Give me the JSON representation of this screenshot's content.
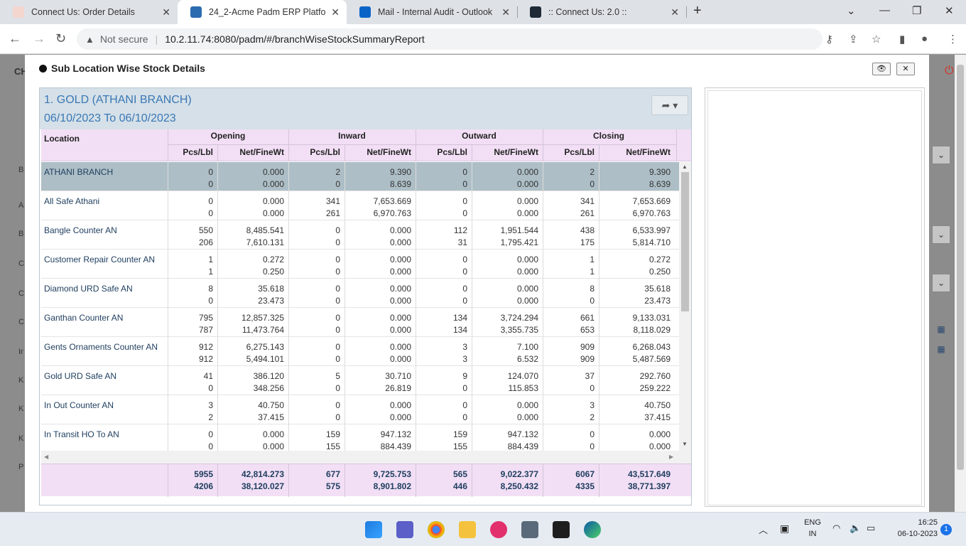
{
  "browser": {
    "tabs": [
      {
        "title": "Connect Us: Order Details",
        "active": false
      },
      {
        "title": "24_2-Acme Padm ERP Platform",
        "active": true
      },
      {
        "title": "Mail - Internal Audit - Outlook",
        "active": false
      },
      {
        "title": ":: Connect Us: 2.0 ::",
        "active": false
      }
    ],
    "security_label": "Not secure",
    "url": "10.2.11.74:8080/padm/#/branchWiseStockSummaryReport"
  },
  "background_page": {
    "letters": [
      "CH",
      "B",
      "A",
      "B",
      "C",
      "C",
      "C",
      "Ir",
      "K",
      "K",
      "K",
      "P"
    ]
  },
  "modal": {
    "title": "Sub Location Wise Stock Details",
    "panel": {
      "heading": "1. GOLD (ATHANI BRANCH)",
      "date_range": "06/10/2023 To 06/10/2023"
    },
    "table": {
      "location_header": "Location",
      "groups": [
        "Opening",
        "Inward",
        "Outward",
        "Closing"
      ],
      "sub_headers": [
        "Pcs/Lbl",
        "Net/FineWt"
      ],
      "rows": [
        {
          "location": "ATHANI BRANCH",
          "selected": true,
          "values": [
            [
              "0",
              "0"
            ],
            [
              "0.000",
              "0.000"
            ],
            [
              "2",
              "0"
            ],
            [
              "9.390",
              "8.639"
            ],
            [
              "0",
              "0"
            ],
            [
              "0.000",
              "0.000"
            ],
            [
              "2",
              "0"
            ],
            [
              "9.390",
              "8.639"
            ]
          ]
        },
        {
          "location": "All Safe Athani",
          "selected": false,
          "values": [
            [
              "0",
              "0"
            ],
            [
              "0.000",
              "0.000"
            ],
            [
              "341",
              "261"
            ],
            [
              "7,653.669",
              "6,970.763"
            ],
            [
              "0",
              "0"
            ],
            [
              "0.000",
              "0.000"
            ],
            [
              "341",
              "261"
            ],
            [
              "7,653.669",
              "6,970.763"
            ]
          ]
        },
        {
          "location": "Bangle Counter AN",
          "selected": false,
          "values": [
            [
              "550",
              "206"
            ],
            [
              "8,485.541",
              "7,610.131"
            ],
            [
              "0",
              "0"
            ],
            [
              "0.000",
              "0.000"
            ],
            [
              "112",
              "31"
            ],
            [
              "1,951.544",
              "1,795.421"
            ],
            [
              "438",
              "175"
            ],
            [
              "6,533.997",
              "5,814.710"
            ]
          ]
        },
        {
          "location": "Customer Repair Counter AN",
          "selected": false,
          "values": [
            [
              "1",
              "1"
            ],
            [
              "0.272",
              "0.250"
            ],
            [
              "0",
              "0"
            ],
            [
              "0.000",
              "0.000"
            ],
            [
              "0",
              "0"
            ],
            [
              "0.000",
              "0.000"
            ],
            [
              "1",
              "1"
            ],
            [
              "0.272",
              "0.250"
            ]
          ]
        },
        {
          "location": "Diamond URD Safe AN",
          "selected": false,
          "values": [
            [
              "8",
              "0"
            ],
            [
              "35.618",
              "23.473"
            ],
            [
              "0",
              "0"
            ],
            [
              "0.000",
              "0.000"
            ],
            [
              "0",
              "0"
            ],
            [
              "0.000",
              "0.000"
            ],
            [
              "8",
              "0"
            ],
            [
              "35.618",
              "23.473"
            ]
          ]
        },
        {
          "location": "Ganthan Counter AN",
          "selected": false,
          "values": [
            [
              "795",
              "787"
            ],
            [
              "12,857.325",
              "11,473.764"
            ],
            [
              "0",
              "0"
            ],
            [
              "0.000",
              "0.000"
            ],
            [
              "134",
              "134"
            ],
            [
              "3,724.294",
              "3,355.735"
            ],
            [
              "661",
              "653"
            ],
            [
              "9,133.031",
              "8,118.029"
            ]
          ]
        },
        {
          "location": "Gents Ornaments Counter AN",
          "selected": false,
          "values": [
            [
              "912",
              "912"
            ],
            [
              "6,275.143",
              "5,494.101"
            ],
            [
              "0",
              "0"
            ],
            [
              "0.000",
              "0.000"
            ],
            [
              "3",
              "3"
            ],
            [
              "7.100",
              "6.532"
            ],
            [
              "909",
              "909"
            ],
            [
              "6,268.043",
              "5,487.569"
            ]
          ]
        },
        {
          "location": "Gold URD Safe AN",
          "selected": false,
          "values": [
            [
              "41",
              "0"
            ],
            [
              "386.120",
              "348.256"
            ],
            [
              "5",
              "0"
            ],
            [
              "30.710",
              "26.819"
            ],
            [
              "9",
              "0"
            ],
            [
              "124.070",
              "115.853"
            ],
            [
              "37",
              "0"
            ],
            [
              "292.760",
              "259.222"
            ]
          ]
        },
        {
          "location": "In Out Counter AN",
          "selected": false,
          "values": [
            [
              "3",
              "2"
            ],
            [
              "40.750",
              "37.415"
            ],
            [
              "0",
              "0"
            ],
            [
              "0.000",
              "0.000"
            ],
            [
              "0",
              "0"
            ],
            [
              "0.000",
              "0.000"
            ],
            [
              "3",
              "2"
            ],
            [
              "40.750",
              "37.415"
            ]
          ]
        },
        {
          "location": "In Transit HO To AN",
          "selected": false,
          "values": [
            [
              "0",
              "0"
            ],
            [
              "0.000",
              "0.000"
            ],
            [
              "159",
              "155"
            ],
            [
              "947.132",
              "884.439"
            ],
            [
              "159",
              "155"
            ],
            [
              "947.132",
              "884.439"
            ],
            [
              "0",
              "0"
            ],
            [
              "0.000",
              "0.000"
            ]
          ]
        }
      ],
      "totals": [
        [
          "5955",
          "4206"
        ],
        [
          "42,814.273",
          "38,120.027"
        ],
        [
          "677",
          "575"
        ],
        [
          "9,725.753",
          "8,901.802"
        ],
        [
          "565",
          "446"
        ],
        [
          "9,022.377",
          "8,250.432"
        ],
        [
          "6067",
          "4335"
        ],
        [
          "43,517.649",
          "38,771.397"
        ]
      ]
    }
  },
  "taskbar": {
    "language": "ENG",
    "region": "IN",
    "time": "16:25",
    "date": "06-10-2023",
    "notification_count": "1"
  },
  "colors": {
    "header_bg": "#f2dff5",
    "selected_row": "#adbec6",
    "heading_text": "#3a78b5"
  }
}
